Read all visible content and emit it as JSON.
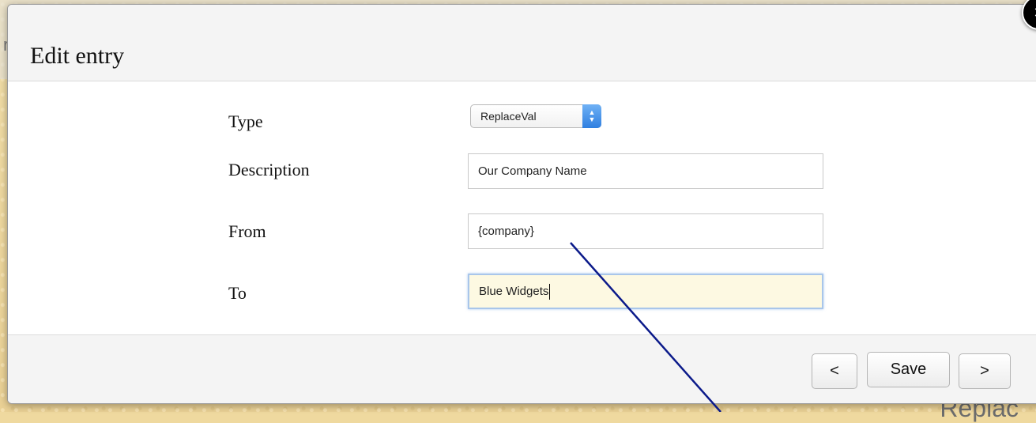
{
  "dialog": {
    "title": "Edit entry",
    "close_glyph": "✕"
  },
  "form": {
    "type_label": "Type",
    "type_value": "ReplaceVal",
    "description_label": "Description",
    "description_value": "Our Company Name",
    "from_label": "From",
    "from_value": "{company}",
    "to_label": "To",
    "to_value": "Blue Widgets"
  },
  "footer": {
    "prev_label": "<",
    "save_label": "Save",
    "next_label": ">"
  },
  "background": {
    "partial_text": "Replac"
  },
  "colors": {
    "annotation_line": "#0b1a8a",
    "focus_border": "#a9c6ea",
    "select_accent": "#3a88e8"
  },
  "icons": {
    "close": "close-icon",
    "select_arrows": "chevron-up-down-icon"
  }
}
